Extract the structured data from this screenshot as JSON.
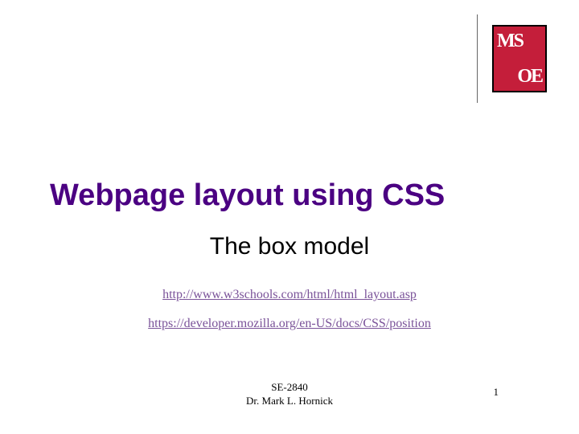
{
  "logo": {
    "line1": "MS",
    "line2": "OE"
  },
  "title": "Webpage layout using CSS",
  "subtitle": "The box model",
  "links": [
    "http://www.w3schools.com/html/html_layout.asp",
    "https://developer.mozilla.org/en-US/docs/CSS/position"
  ],
  "footer": {
    "course": "SE-2840",
    "author": "Dr. Mark L. Hornick",
    "page": "1"
  }
}
